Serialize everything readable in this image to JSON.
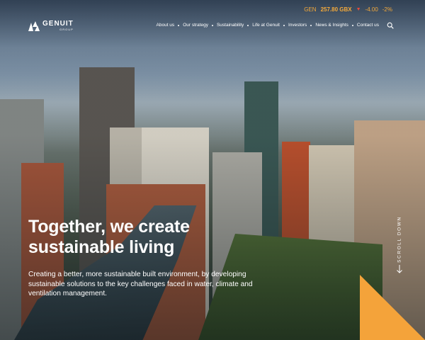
{
  "ticker": {
    "symbol": "GEN",
    "price": "257.80 GBX",
    "change": "-4.00",
    "change_pct": "-2%"
  },
  "logo": {
    "name": "GENUIT",
    "sub": "GROUP"
  },
  "nav": {
    "items": [
      "About us",
      "Our strategy",
      "Sustainability",
      "Life at Genuit",
      "Investors",
      "News & Insights",
      "Contact us"
    ]
  },
  "hero": {
    "headline_line1": "Together, we create",
    "headline_line2": "sustainable living",
    "subcopy": "Creating a better, more sustainable built environment, by developing sustainable solutions to the key challenges faced in water, climate and ventilation management.",
    "scroll_label": "SCROLL DOWN"
  },
  "colors": {
    "accent": "#f4a33a",
    "negative": "#e84a3c"
  },
  "icons": {
    "search": "search-icon",
    "scroll": "arrow-down-icon",
    "logo": "genuit-logo-mark"
  }
}
